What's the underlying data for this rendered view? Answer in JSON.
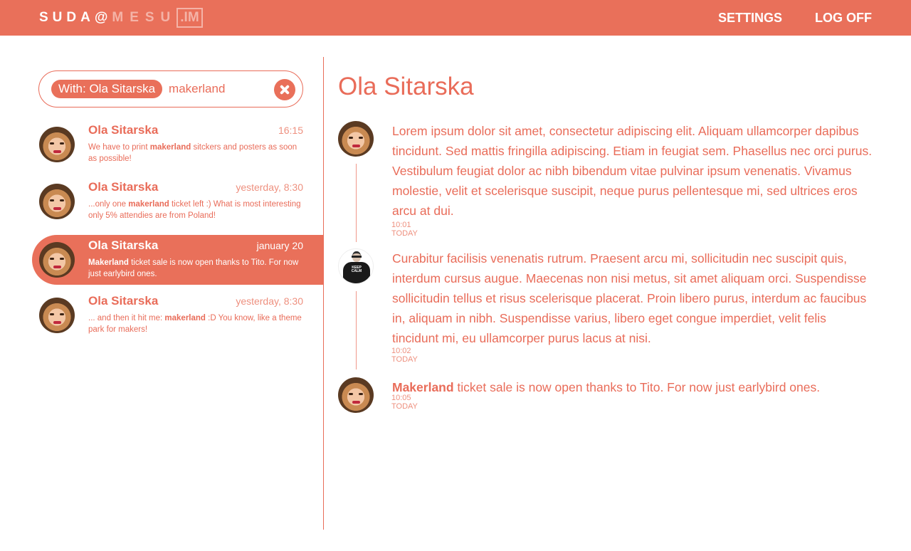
{
  "header": {
    "logo": {
      "part1": "SUDA@",
      "part2": "MESU",
      "part3": ".IM"
    },
    "nav": {
      "settings": "SETTINGS",
      "logoff": "LOG OFF"
    }
  },
  "search": {
    "chip": "With: Ola Sitarska",
    "query": "makerland"
  },
  "conversations": [
    {
      "name": "Ola Sitarska",
      "time": "16:15",
      "pre": "We have to print ",
      "bold": "makerland",
      "post": " sitckers  and posters as soon as possible!"
    },
    {
      "name": "Ola Sitarska",
      "time": "yesterday, 8:30",
      "pre": "...only one ",
      "bold": "makerland",
      "post": " ticket left :) What is most interesting only 5% attendies are from Poland!"
    },
    {
      "name": "Ola Sitarska",
      "time": "january 20",
      "pre": "",
      "bold": "Makerland",
      "post": " ticket sale is now open thanks to Tito. For now just earlybird ones."
    },
    {
      "name": "Ola Sitarska",
      "time": "yesterday, 8:30",
      "pre": "... and then it hit me: ",
      "bold": "makerland",
      "post": " :D You know, like a theme park for makers!"
    }
  ],
  "chat": {
    "title": "Ola Sitarska",
    "messages": [
      {
        "text": "Lorem ipsum dolor sit amet, consectetur adipiscing elit. Aliquam ullamcorper dapibus  tincidunt. Sed mattis fringilla adipiscing. Etiam in feugiat sem. Phasellus nec orci purus. Vestibulum feugiat dolor ac nibh bibendum vitae pulvinar ipsum venenatis. Vivamus molestie, velit et scelerisque suscipit, neque purus pellentesque mi, sed ultrices eros arcu at dui.",
        "time": "10:01 TODAY"
      },
      {
        "text": "Curabitur facilisis venenatis rutrum. Praesent arcu mi, sollicitudin nec suscipit quis, interdum cursus augue. Maecenas non nisi metus, sit amet aliquam orci. Suspendisse sollicitudin tellus et risus scelerisque placerat. Proin libero purus, interdum ac faucibus in, aliquam in nibh. Suspendisse varius, libero eget congue imperdiet, velit felis tincidunt mi, eu ullamcorper purus lacus at nisi.",
        "time": "10:02 TODAY"
      },
      {
        "bold": "Makerland",
        "text": " ticket sale is now open thanks to Tito. For now just earlybird ones.",
        "time": "10:05 TODAY"
      }
    ],
    "avatar_shirt_text": "KEEP CALM"
  },
  "colors": {
    "accent": "#e9705a",
    "muted": "#ee907f",
    "background": "#ffffff"
  }
}
